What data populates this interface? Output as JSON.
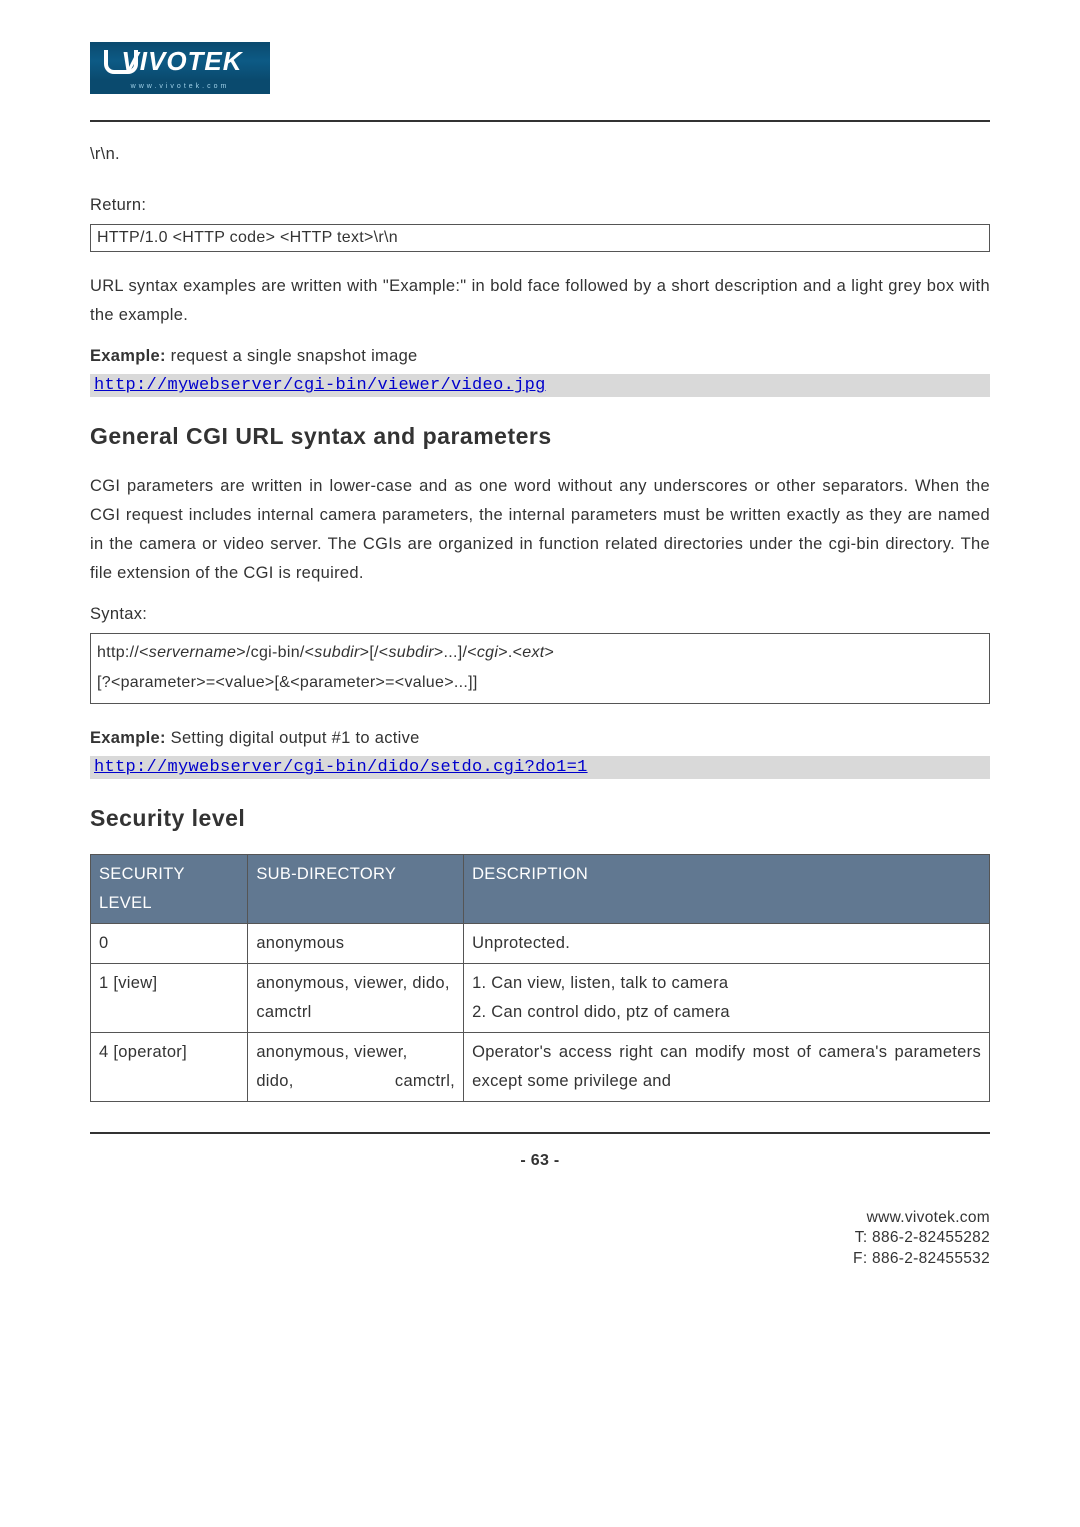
{
  "logo": {
    "brand": "VIVOTEK",
    "tagline": "www.vivotek.com"
  },
  "intro": {
    "rn": "\\r\\n.",
    "return_label": "Return:",
    "return_box": "HTTP/1.0 <HTTP code> <HTTP text>\\r\\n",
    "syntax_desc": "URL syntax examples are written with \"Example:\" in bold face followed by a short description and a light grey box with the example.",
    "example1_label": "Example:",
    "example1_text": " request a single snapshot image",
    "example1_url": "http://mywebserver/cgi-bin/viewer/video.jpg"
  },
  "section1": {
    "heading": "General CGI URL syntax and parameters",
    "para": "CGI parameters are written in lower-case and as one word without any underscores or other separators. When the CGI request includes internal camera parameters, the internal parameters must be written exactly as they are named in the camera or video server. The CGIs are organized in function related directories under the cgi-bin directory. The file extension of the CGI is required.",
    "syntax_label": "Syntax:",
    "syntax_line1_a": "http://<",
    "syntax_line1_b": "servername",
    "syntax_line1_c": ">/cgi-bin/<",
    "syntax_line1_d": "subdir",
    "syntax_line1_e": ">[/<",
    "syntax_line1_f": "subdir",
    "syntax_line1_g": ">...]/<",
    "syntax_line1_h": "cgi",
    "syntax_line1_i": ">.<",
    "syntax_line1_j": "ext",
    "syntax_line1_k": ">",
    "syntax_line2": "[?<parameter>=<value>[&<parameter>=<value>...]]",
    "example2_label": "Example:",
    "example2_text": " Setting digital output #1 to active",
    "example2_url": "http://mywebserver/cgi-bin/dido/setdo.cgi?do1=1"
  },
  "section2": {
    "heading": "Security level",
    "table": {
      "headers": [
        "SECURITY LEVEL",
        "SUB-DIRECTORY",
        "DESCRIPTION"
      ],
      "rows": [
        {
          "level": "0",
          "subdir": "anonymous",
          "desc": "Unprotected."
        },
        {
          "level": "1 [view]",
          "subdir": "anonymous, viewer, dido, camctrl",
          "desc_l1": "1. Can view, listen, talk to camera",
          "desc_l2": "2. Can control dido, ptz of camera"
        },
        {
          "level": "4 [operator]",
          "subdir_l1": "anonymous, viewer,",
          "subdir_l2a": "dido,",
          "subdir_l2b": "camctrl,",
          "desc": "Operator's access right can modify most of camera's parameters except some privilege and"
        }
      ]
    }
  },
  "footer": {
    "page": "- 63 -",
    "url": "www.vivotek.com",
    "tel": "T: 886-2-82455282",
    "fax": "F: 886-2-82455532"
  }
}
